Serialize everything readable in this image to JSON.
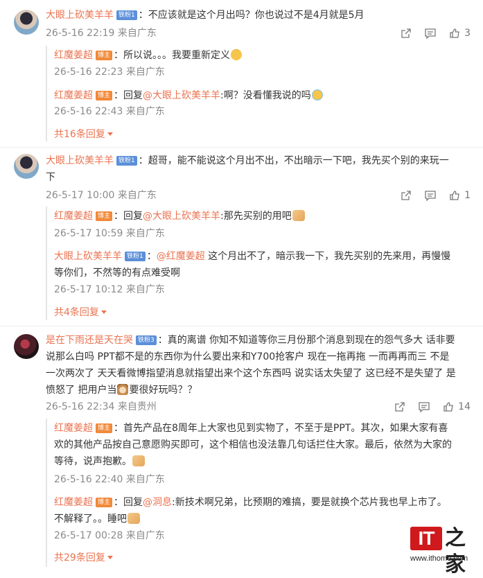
{
  "comments": [
    {
      "author": "大眼上砍美羊羊",
      "badge": "铁粉1",
      "text": "：不应该就是这个月出吗？你也说过不是4月就是5月",
      "time": "26-5-16 22:19 来自广东",
      "likes": "3",
      "replies": [
        {
          "author": "红魔姜超",
          "badge": "博主",
          "text": "：所以说。。。我要重新定义",
          "emoji": "smirk",
          "time": "26-5-16 22:23 来自广东"
        },
        {
          "author": "红魔姜超",
          "badge": "博主",
          "text_prefix": "：回复",
          "mention": "@大眼上砍美羊羊",
          "text": ":啊？没看懂我说的吗",
          "emoji": "laugh-cry",
          "time": "26-5-16 22:43 来自广东"
        }
      ],
      "more": "共16条回复"
    },
    {
      "author": "大眼上砍美羊羊",
      "badge": "铁粉1",
      "text_line1": "：超哥，能不能说这个月出不出，不出暗示一下吧，我先买个别的来玩一",
      "text_line2": "下",
      "time": "26-5-17 10:00 来自广东",
      "likes": "1",
      "replies": [
        {
          "author": "红魔姜超",
          "badge": "博主",
          "text_prefix": "：回复",
          "mention": "@大眼上砍美羊羊",
          "text": ":那先买别的用吧",
          "emoji": "folded-hands",
          "time": "26-5-17 10:59 来自广东"
        },
        {
          "author": "大眼上砍美羊羊",
          "badge": "铁粉1",
          "text_prefix": "：",
          "mention": "@红魔姜超",
          "text_line1": " 这个月出不了，暗示我一下，我先买别的先来用，再慢慢",
          "text_line2": "等你们，不然等的有点难受啊",
          "time": "26-5-17 10:12 来自广东"
        }
      ],
      "more": "共4条回复"
    },
    {
      "author": "是在下雨还是天在哭",
      "badge": "铁粉3",
      "text_line1": "：真的离谱 你知不知道等你三月份那个消息到现在的怨气多大 话非要",
      "text_line2": "说那么白吗 PPT都不是的东西你为什么要出来和Y700抢客户 现在一拖再拖 一而再再而三 不是",
      "text_line3": "一次两次了 天天看微博指望消息就指望出来个这个东西吗 说实话太失望了 这已经不是失望了 是",
      "text_line4a": "愤怒了 把用户当",
      "text_line4b": "要很好玩吗？？",
      "emoji": "dog",
      "time": "26-5-16 22:34 来自贵州",
      "likes": "14",
      "replies": [
        {
          "author": "红魔姜超",
          "badge": "博主",
          "text_line1": "：首先产品在8周年上大家也见到实物了，不至于是PPT。其次，如果大家有喜",
          "text_line2": "欢的其他产品按自己意愿购买即可，这个相信也没法靠几句话拦住大家。最后，依然为大家的",
          "text_line3": "等待，说声抱歉。",
          "emoji": "folded-hands",
          "time": "26-5-16 22:40 来自广东"
        },
        {
          "author": "红魔姜超",
          "badge": "博主",
          "text_prefix": "：回复",
          "mention": "@洞息",
          "text_line1": ":新技术啊兄弟，比预期的难搞，要是就换个芯片我也早上市了。",
          "text_line2": "不解释了。。睡吧",
          "emoji": "folded-hands",
          "time": "26-5-17 00:28 来自广东"
        }
      ],
      "more": "共29条回复"
    }
  ],
  "watermark": {
    "logo_text": "IT",
    "logo_zh": "之家",
    "url": "www.ithome.com"
  },
  "colors": {
    "name": "#eb7350",
    "text": "#333333",
    "meta": "#8a8a8a",
    "badge_fan": "#5b8fd9",
    "badge_owner": "#f08a3a",
    "logo_red": "#d0191c"
  }
}
